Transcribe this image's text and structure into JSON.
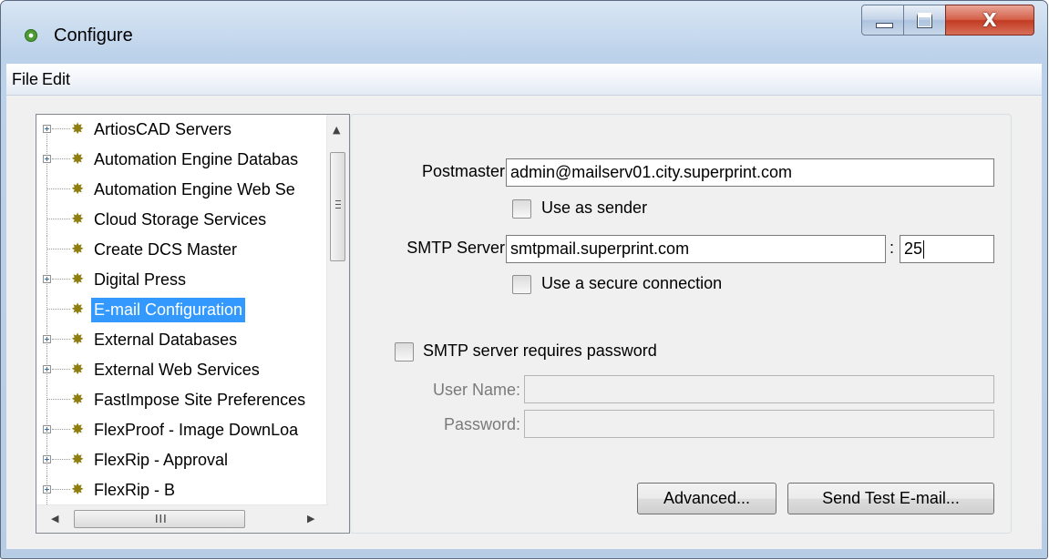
{
  "window": {
    "title": "Configure",
    "controls": {
      "minimize_icon": "minimize-icon",
      "maximize_icon": "maximize-icon",
      "close_glyph": "X"
    }
  },
  "menu": [
    "File",
    "Edit"
  ],
  "tree": {
    "items": [
      {
        "label": "ArtiosCAD Servers",
        "expandable": true,
        "selected": false
      },
      {
        "label": "Automation Engine Databas",
        "expandable": true,
        "selected": false
      },
      {
        "label": "Automation Engine Web Se",
        "expandable": false,
        "selected": false
      },
      {
        "label": "Cloud Storage Services",
        "expandable": false,
        "selected": false
      },
      {
        "label": "Create DCS Master",
        "expandable": false,
        "selected": false
      },
      {
        "label": "Digital Press",
        "expandable": true,
        "selected": false
      },
      {
        "label": "E-mail Configuration",
        "expandable": false,
        "selected": true
      },
      {
        "label": "External Databases",
        "expandable": true,
        "selected": false
      },
      {
        "label": "External Web Services",
        "expandable": true,
        "selected": false
      },
      {
        "label": "FastImpose Site Preferences",
        "expandable": false,
        "selected": false
      },
      {
        "label": "FlexProof - Image DownLoa",
        "expandable": true,
        "selected": false
      },
      {
        "label": "FlexRip - Approval",
        "expandable": true,
        "selected": false
      },
      {
        "label": "FlexRip - B",
        "expandable": true,
        "selected": false
      }
    ],
    "item_icon": "gear-icon",
    "scrollbar_grip": "III"
  },
  "form": {
    "postmaster": {
      "label": "Postmaster:",
      "value": "admin@mailserv01.city.superprint.com"
    },
    "use_as_sender": {
      "label": "Use as sender",
      "checked": false
    },
    "smtp": {
      "label": "SMTP Server:",
      "value": "smtpmail.superprint.com",
      "port_sep": ":",
      "port": "25"
    },
    "secure": {
      "label": "Use a secure connection",
      "checked": false
    },
    "requires_password": {
      "label": "SMTP server requires password",
      "checked": false
    },
    "username": {
      "label": "User Name:",
      "value": ""
    },
    "password": {
      "label": "Password:",
      "value": ""
    },
    "buttons": {
      "advanced": "Advanced...",
      "send_test": "Send Test E-mail..."
    }
  }
}
